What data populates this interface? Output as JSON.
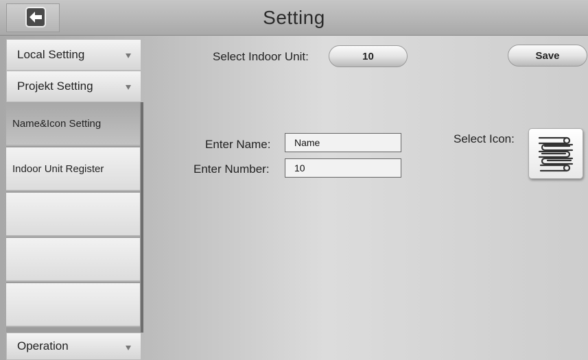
{
  "header": {
    "title": "Setting",
    "back_icon": "back-arrow-icon"
  },
  "sidebar": {
    "local_setting": "Local Setting",
    "projekt_setting": "Projekt Setting",
    "sub_items": [
      {
        "label": "Name&Icon Setting",
        "active": true
      },
      {
        "label": "Indoor Unit Register",
        "active": false
      },
      {
        "label": "",
        "active": false
      },
      {
        "label": "",
        "active": false
      },
      {
        "label": "",
        "active": false
      }
    ],
    "operation": "Operation"
  },
  "main": {
    "select_indoor_unit_label": "Select Indoor Unit:",
    "indoor_unit_value": "10",
    "save_label": "Save",
    "enter_name_label": "Enter Name:",
    "name_value": "Name",
    "enter_number_label": "Enter Number:",
    "number_value": "10",
    "select_icon_label": "Select Icon:",
    "selected_icon": "books-stack-icon"
  }
}
